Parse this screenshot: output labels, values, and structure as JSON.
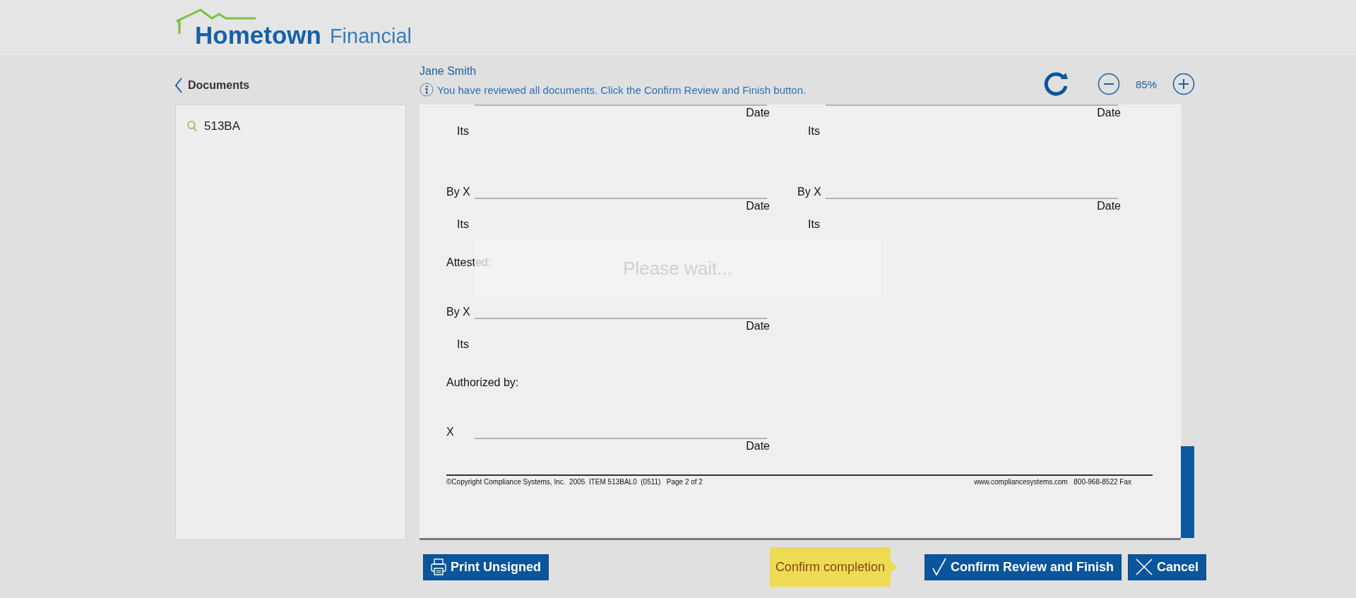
{
  "logo": {
    "name": "Hometown",
    "suffix": "Financial"
  },
  "sidebar": {
    "title": "Documents",
    "items": [
      {
        "label": "513BA"
      }
    ]
  },
  "viewer": {
    "user": "Jane Smith",
    "notice": "You have reviewed all documents. Click the Confirm Review and Finish button.",
    "zoom": "85%"
  },
  "document": {
    "sections": [
      {
        "kind": "signatures",
        "blocks": [
          {
            "date": "Date",
            "its": "Its"
          },
          {
            "date": "Date",
            "its": "Its"
          }
        ]
      },
      {
        "kind": "signatures",
        "blocks": [
          {
            "by": "By X",
            "date": "Date",
            "its": "Its"
          },
          {
            "by": "By X",
            "date": "Date",
            "its": "Its"
          }
        ]
      },
      {
        "kind": "label",
        "text": "Attested:"
      },
      {
        "kind": "signatures",
        "blocks": [
          {
            "by": "By X",
            "date": "Date",
            "its": "Its"
          }
        ]
      },
      {
        "kind": "label",
        "text": "Authorized by:"
      },
      {
        "kind": "signatures",
        "blocks": [
          {
            "by": "X",
            "date": "Date"
          }
        ]
      }
    ],
    "footer_left": "©Copyright Compliance Systems, Inc.  2005  ITEM 513BAL0  (0511)   Page 2 of 2",
    "footer_right": "www.compliancesystems.com   800-968-8522 Fax"
  },
  "overlay": {
    "text": "Please wait..."
  },
  "actions": {
    "print": "Print Unsigned",
    "hint": "Confirm completion",
    "confirm": "Confirm Review and Finish",
    "cancel": "Cancel"
  }
}
